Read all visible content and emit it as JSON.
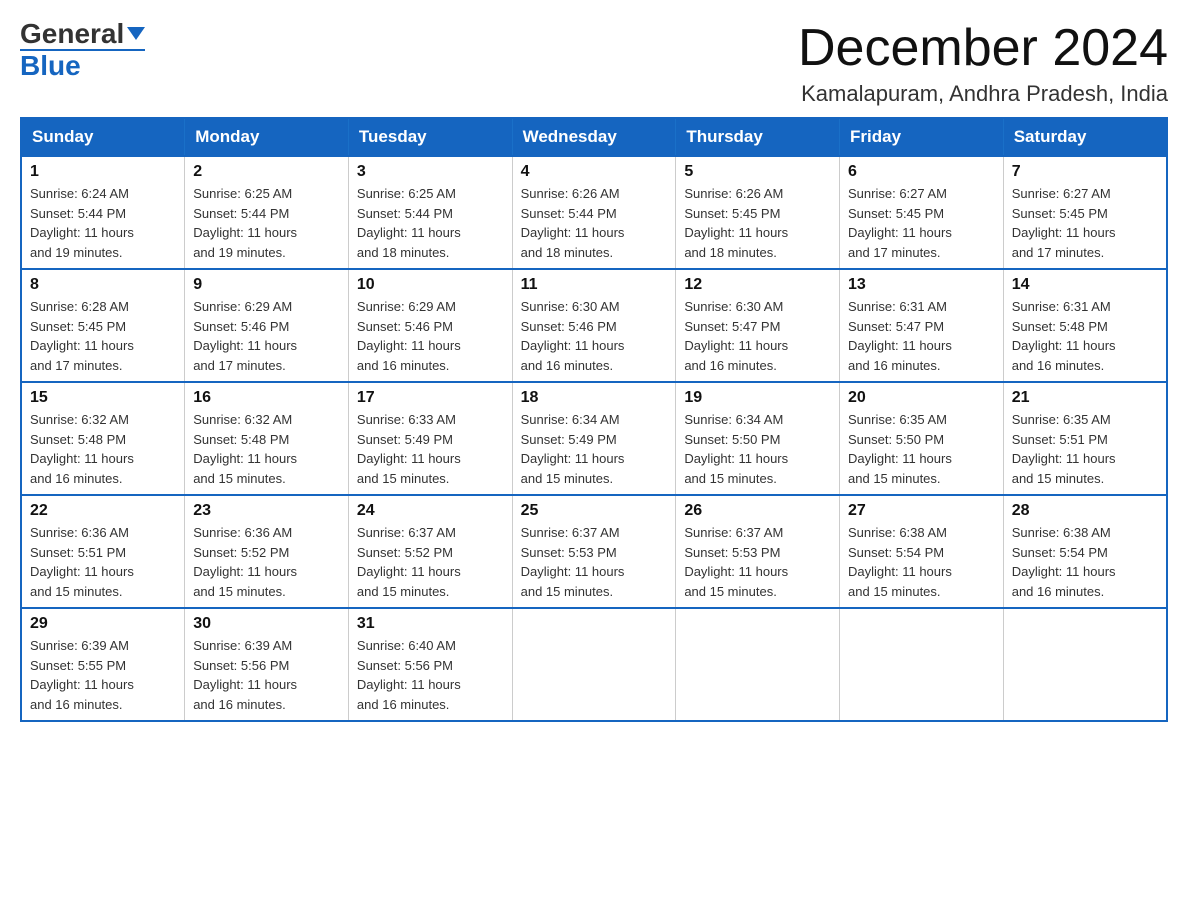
{
  "header": {
    "logo_general": "General",
    "logo_blue": "Blue",
    "main_title": "December 2024",
    "subtitle": "Kamalapuram, Andhra Pradesh, India"
  },
  "days_of_week": [
    "Sunday",
    "Monday",
    "Tuesday",
    "Wednesday",
    "Thursday",
    "Friday",
    "Saturday"
  ],
  "weeks": [
    [
      {
        "day": "1",
        "sunrise": "6:24 AM",
        "sunset": "5:44 PM",
        "daylight": "11 hours and 19 minutes."
      },
      {
        "day": "2",
        "sunrise": "6:25 AM",
        "sunset": "5:44 PM",
        "daylight": "11 hours and 19 minutes."
      },
      {
        "day": "3",
        "sunrise": "6:25 AM",
        "sunset": "5:44 PM",
        "daylight": "11 hours and 18 minutes."
      },
      {
        "day": "4",
        "sunrise": "6:26 AM",
        "sunset": "5:44 PM",
        "daylight": "11 hours and 18 minutes."
      },
      {
        "day": "5",
        "sunrise": "6:26 AM",
        "sunset": "5:45 PM",
        "daylight": "11 hours and 18 minutes."
      },
      {
        "day": "6",
        "sunrise": "6:27 AM",
        "sunset": "5:45 PM",
        "daylight": "11 hours and 17 minutes."
      },
      {
        "day": "7",
        "sunrise": "6:27 AM",
        "sunset": "5:45 PM",
        "daylight": "11 hours and 17 minutes."
      }
    ],
    [
      {
        "day": "8",
        "sunrise": "6:28 AM",
        "sunset": "5:45 PM",
        "daylight": "11 hours and 17 minutes."
      },
      {
        "day": "9",
        "sunrise": "6:29 AM",
        "sunset": "5:46 PM",
        "daylight": "11 hours and 17 minutes."
      },
      {
        "day": "10",
        "sunrise": "6:29 AM",
        "sunset": "5:46 PM",
        "daylight": "11 hours and 16 minutes."
      },
      {
        "day": "11",
        "sunrise": "6:30 AM",
        "sunset": "5:46 PM",
        "daylight": "11 hours and 16 minutes."
      },
      {
        "day": "12",
        "sunrise": "6:30 AM",
        "sunset": "5:47 PM",
        "daylight": "11 hours and 16 minutes."
      },
      {
        "day": "13",
        "sunrise": "6:31 AM",
        "sunset": "5:47 PM",
        "daylight": "11 hours and 16 minutes."
      },
      {
        "day": "14",
        "sunrise": "6:31 AM",
        "sunset": "5:48 PM",
        "daylight": "11 hours and 16 minutes."
      }
    ],
    [
      {
        "day": "15",
        "sunrise": "6:32 AM",
        "sunset": "5:48 PM",
        "daylight": "11 hours and 16 minutes."
      },
      {
        "day": "16",
        "sunrise": "6:32 AM",
        "sunset": "5:48 PM",
        "daylight": "11 hours and 15 minutes."
      },
      {
        "day": "17",
        "sunrise": "6:33 AM",
        "sunset": "5:49 PM",
        "daylight": "11 hours and 15 minutes."
      },
      {
        "day": "18",
        "sunrise": "6:34 AM",
        "sunset": "5:49 PM",
        "daylight": "11 hours and 15 minutes."
      },
      {
        "day": "19",
        "sunrise": "6:34 AM",
        "sunset": "5:50 PM",
        "daylight": "11 hours and 15 minutes."
      },
      {
        "day": "20",
        "sunrise": "6:35 AM",
        "sunset": "5:50 PM",
        "daylight": "11 hours and 15 minutes."
      },
      {
        "day": "21",
        "sunrise": "6:35 AM",
        "sunset": "5:51 PM",
        "daylight": "11 hours and 15 minutes."
      }
    ],
    [
      {
        "day": "22",
        "sunrise": "6:36 AM",
        "sunset": "5:51 PM",
        "daylight": "11 hours and 15 minutes."
      },
      {
        "day": "23",
        "sunrise": "6:36 AM",
        "sunset": "5:52 PM",
        "daylight": "11 hours and 15 minutes."
      },
      {
        "day": "24",
        "sunrise": "6:37 AM",
        "sunset": "5:52 PM",
        "daylight": "11 hours and 15 minutes."
      },
      {
        "day": "25",
        "sunrise": "6:37 AM",
        "sunset": "5:53 PM",
        "daylight": "11 hours and 15 minutes."
      },
      {
        "day": "26",
        "sunrise": "6:37 AM",
        "sunset": "5:53 PM",
        "daylight": "11 hours and 15 minutes."
      },
      {
        "day": "27",
        "sunrise": "6:38 AM",
        "sunset": "5:54 PM",
        "daylight": "11 hours and 15 minutes."
      },
      {
        "day": "28",
        "sunrise": "6:38 AM",
        "sunset": "5:54 PM",
        "daylight": "11 hours and 16 minutes."
      }
    ],
    [
      {
        "day": "29",
        "sunrise": "6:39 AM",
        "sunset": "5:55 PM",
        "daylight": "11 hours and 16 minutes."
      },
      {
        "day": "30",
        "sunrise": "6:39 AM",
        "sunset": "5:56 PM",
        "daylight": "11 hours and 16 minutes."
      },
      {
        "day": "31",
        "sunrise": "6:40 AM",
        "sunset": "5:56 PM",
        "daylight": "11 hours and 16 minutes."
      },
      null,
      null,
      null,
      null
    ]
  ],
  "labels": {
    "sunrise": "Sunrise:",
    "sunset": "Sunset:",
    "daylight": "Daylight:"
  }
}
